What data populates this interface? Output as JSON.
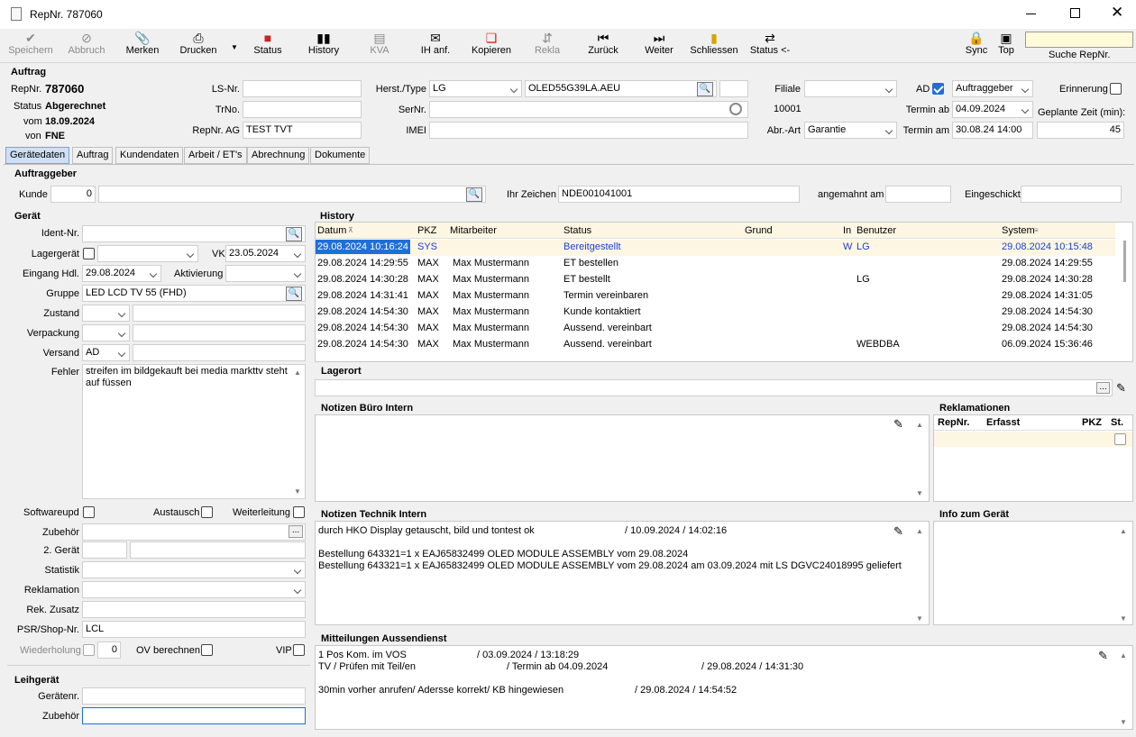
{
  "window": {
    "title": "RepNr. 787060"
  },
  "toolbar": {
    "buttons": [
      {
        "label": "Speichern",
        "icon": "check-icon"
      },
      {
        "label": "Abbruch",
        "icon": "cancel-icon"
      },
      {
        "label": "Merken",
        "icon": "paperclip-icon"
      },
      {
        "label": "Drucken",
        "icon": "printer-icon"
      },
      {
        "label": "Status",
        "icon": "status-icon"
      },
      {
        "label": "History",
        "icon": "history-icon"
      },
      {
        "label": "KVA",
        "icon": "kva-icon"
      },
      {
        "label": "IH anf.",
        "icon": "mail-icon"
      },
      {
        "label": "Kopieren",
        "icon": "copy-icon"
      },
      {
        "label": "Rekla",
        "icon": "rekla-icon"
      },
      {
        "label": "Zurück",
        "icon": "back-icon"
      },
      {
        "label": "Weiter",
        "icon": "forward-icon"
      },
      {
        "label": "Schliessen",
        "icon": "close-doc-icon"
      },
      {
        "label": "Status <-",
        "icon": "status-back-icon"
      }
    ],
    "sync_label": "Sync",
    "top_label": "Top",
    "search_label": "Suche RepNr.",
    "search_value": ""
  },
  "auftrag": {
    "section": "Auftrag",
    "repnr_label": "RepNr.",
    "repnr": "787060",
    "status_label": "Status",
    "status": "Abgerechnet",
    "vom_label": "vom",
    "vom": "18.09.2024",
    "von_label": "von",
    "von": "FNE",
    "lsnr_label": "LS-Nr.",
    "lsnr": "",
    "trno_label": "TrNo.",
    "trno": "",
    "repnr_ag_label": "RepNr. AG",
    "repnr_ag": "TEST TVT",
    "herst_label": "Herst./Type",
    "herst": "LG",
    "type": "OLED55G39LA.AEU",
    "sernr_label": "SerNr.",
    "sernr": "",
    "imei_label": "IMEI",
    "imei": "",
    "filiale_label": "Filiale",
    "filiale": "",
    "filiale_nr": "10001",
    "abr_label": "Abr.-Art",
    "abr": "Garantie",
    "ad_label": "AD",
    "ad_value": "Auftraggeber",
    "termin_ab_label": "Termin ab",
    "termin_ab": "04.09.2024",
    "termin_am_label": "Termin am",
    "termin_am": "30.08.24 14:00",
    "erinnerung_label": "Erinnerung",
    "geplante_label": "Geplante Zeit (min):",
    "geplante": "45"
  },
  "tabs": [
    "Gerätedaten",
    "Auftrag",
    "Kundendaten",
    "Arbeit / ET's",
    "Abrechnung",
    "Dokumente"
  ],
  "auftraggeber": {
    "section": "Auftraggeber",
    "kunde_label": "Kunde",
    "kunde_nr": "0",
    "kunde_name": "",
    "ihr_zeichen_label": "Ihr Zeichen",
    "ihr_zeichen": "NDE001041001",
    "angemahnt_label": "angemahnt am",
    "angemahnt": "",
    "eingeschickt_label": "Eingeschickt",
    "eingeschickt": ""
  },
  "geraet": {
    "section": "Gerät",
    "ident_label": "Ident-Nr.",
    "ident": "",
    "lager_label": "Lagergerät",
    "vk_label": "VK",
    "vk": "23.05.2024",
    "eingang_label": "Eingang Hdl.",
    "eingang": "29.08.2024",
    "aktivierung_label": "Aktivierung",
    "gruppe_label": "Gruppe",
    "gruppe": "LED LCD TV 55 (FHD)",
    "zustand_label": "Zustand",
    "verpackung_label": "Verpackung",
    "versand_label": "Versand",
    "versand": "AD",
    "fehler_label": "Fehler",
    "fehler": "streifen im bildgekauft bei media markttv steht\nauf füssen",
    "softwareupd_label": "Softwareupd",
    "austausch_label": "Austausch",
    "weiterleitung_label": "Weiterleitung",
    "zubehoer_label": "Zubehör",
    "zweites_label": "2. Gerät",
    "statistik_label": "Statistik",
    "reklamation_label": "Reklamation",
    "rekzusatz_label": "Rek. Zusatz",
    "psr_label": "PSR/Shop-Nr.",
    "psr": "LCL",
    "wiederholung_label": "Wiederholung",
    "wiederholung": "0",
    "ov_label": "OV berechnen",
    "vip_label": "VIP"
  },
  "leihgeraet": {
    "section": "Leihgerät",
    "geraetenr_label": "Gerätenr.",
    "zubehoer_label": "Zubehör"
  },
  "history": {
    "section": "History",
    "columns": [
      "Datum",
      "PKZ",
      "Mitarbeiter",
      "Status",
      "Grund",
      "In",
      "Benutzer",
      "System"
    ],
    "rows": [
      [
        "29.08.2024 10:16:24",
        "SYS",
        "",
        "Bereitgestellt",
        "",
        "W",
        "LG",
        "29.08.2024 10:15:48"
      ],
      [
        "29.08.2024 14:29:55",
        "MAX",
        "Max Mustermann",
        "ET bestellen",
        "",
        "",
        "",
        "29.08.2024 14:29:55"
      ],
      [
        "29.08.2024 14:30:28",
        "MAX",
        "Max Mustermann",
        "ET bestellt",
        "",
        "",
        "LG",
        "29.08.2024 14:30:28"
      ],
      [
        "29.08.2024 14:31:41",
        "MAX",
        "Max Mustermann",
        "Termin vereinbaren",
        "",
        "",
        "",
        "29.08.2024 14:31:05"
      ],
      [
        "29.08.2024 14:54:30",
        "MAX",
        "Max Mustermann",
        "Kunde kontaktiert",
        "",
        "",
        "",
        "29.08.2024 14:54:30"
      ],
      [
        "29.08.2024 14:54:30",
        "MAX",
        "Max Mustermann",
        "Aussend. vereinbart",
        "",
        "",
        "",
        "29.08.2024 14:54:30"
      ],
      [
        "29.08.2024 14:54:30",
        "MAX",
        "Max Mustermann",
        "Aussend. vereinbart",
        "",
        "",
        "WEBDBA",
        "06.09.2024 15:36:46"
      ]
    ]
  },
  "lagerort": {
    "section": "Lagerort"
  },
  "notizen_buero": {
    "section": "Notizen Büro Intern"
  },
  "reklamationen": {
    "section": "Reklamationen",
    "columns": [
      "RepNr.",
      "Erfasst",
      "PKZ",
      "St."
    ]
  },
  "notizen_technik": {
    "section": "Notizen Technik Intern",
    "line1a": "durch HKO Display getauscht, bild und tontest ok",
    "line1b": "/ 10.09.2024 / 14:02:16",
    "line2": "Bestellung 643321=1 x EAJ65832499 OLED MODULE ASSEMBLY vom 29.08.2024",
    "line3": "Bestellung 643321=1 x EAJ65832499 OLED MODULE ASSEMBLY vom 29.08.2024 am 03.09.2024 mit LS DGVC24018995 geliefert"
  },
  "info_geraet": {
    "section": "Info zum Gerät"
  },
  "mitteilungen": {
    "section": "Mitteilungen Aussendienst",
    "l1a": "1 Pos Kom. im VOS",
    "l1b": "/ 03.09.2024 / 13:18:29",
    "l2a": "TV / Prüfen mit Teil/en",
    "l2b": "/ Termin ab 04.09.2024",
    "l2c": "/ 29.08.2024 / 14:31:30",
    "l3a": "30min vorher anrufen/ Adersse korrekt/ KB hingewiesen",
    "l3b": "/ 29.08.2024 / 14:54:52"
  },
  "colors": {
    "accent": "#1e6fd9",
    "selected_row": "#cfe0f5",
    "row_highlight": "#fdf6e3",
    "tab_active": "#cfe0f5"
  }
}
